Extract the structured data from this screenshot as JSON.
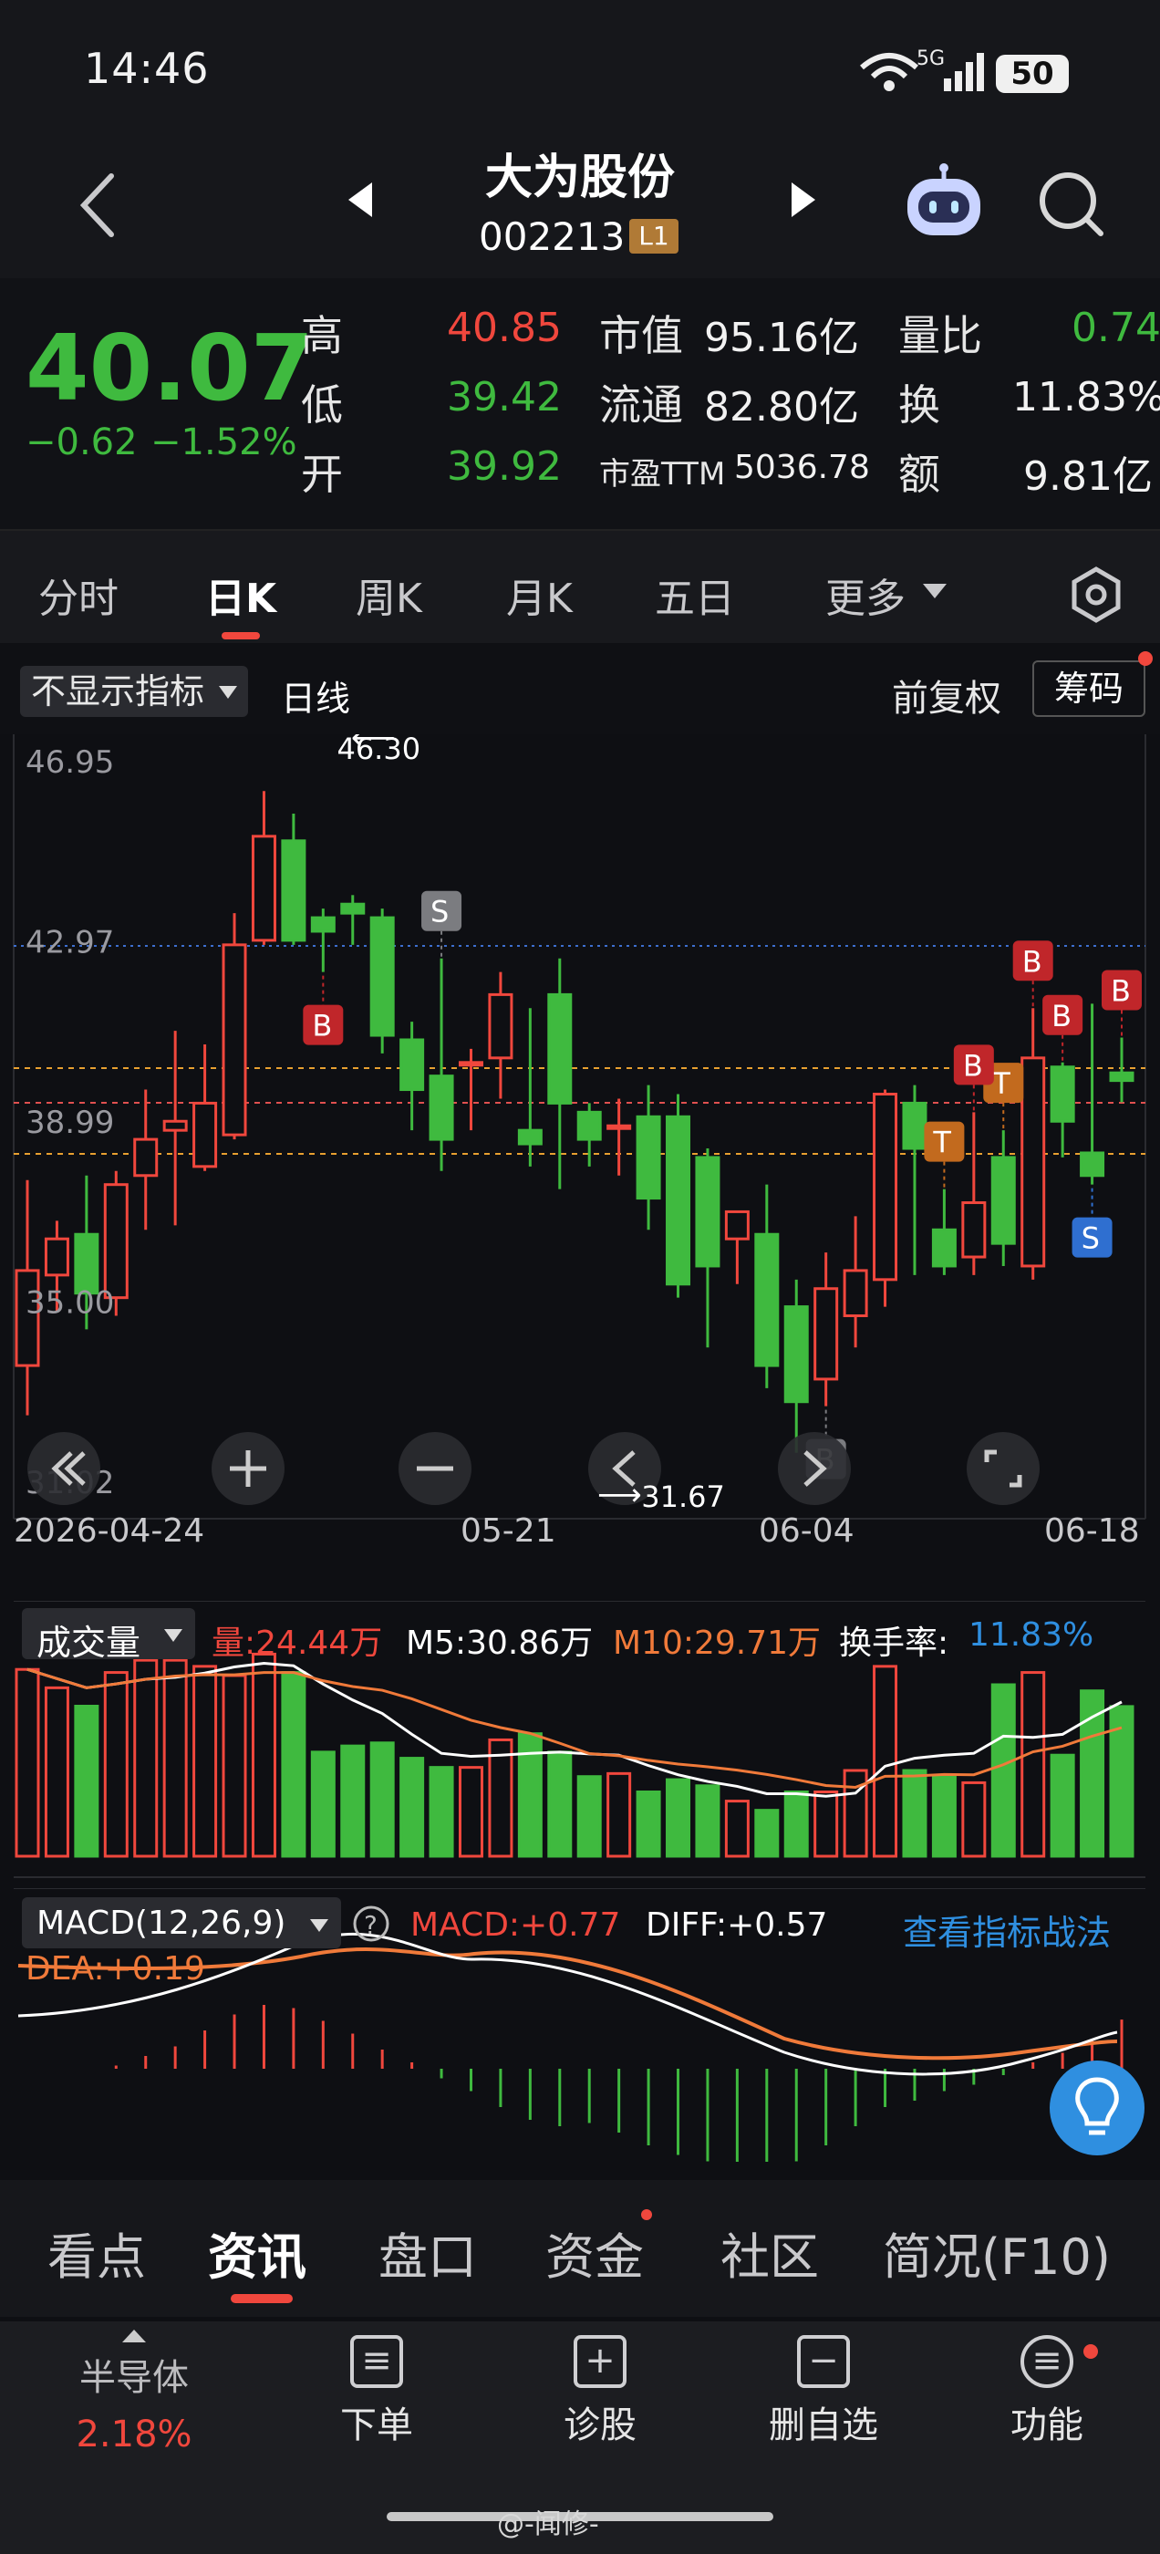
{
  "status": {
    "time": "14:46",
    "battery": "50",
    "network": "5G"
  },
  "header": {
    "stock_name": "大为股份",
    "stock_code": "002213",
    "level": "L1"
  },
  "quote": {
    "price": "40.07",
    "change": "−0.62",
    "change_pct": "−1.52%",
    "high_label": "高",
    "high": "40.85",
    "low_label": "低",
    "low": "39.42",
    "open_label": "开",
    "open": "39.92",
    "mktcap_label": "市值",
    "mktcap": "95.16亿",
    "float_label": "流通",
    "float": "82.80亿",
    "pe_label": "市盈TTM",
    "pe": "5036.78",
    "volratio_label": "量比",
    "volratio": "0.74",
    "turnover_label": "换",
    "turnover": "11.83%",
    "amount_label": "额",
    "amount": "9.81亿"
  },
  "period_tabs": [
    "分时",
    "日K",
    "周K",
    "月K",
    "五日",
    "更多"
  ],
  "chart_toolbar": {
    "indicator": "不显示指标",
    "line_type": "日线",
    "adjust": "前复权",
    "chips": "筹码"
  },
  "kline": {
    "y_ticks": [
      "46.95",
      "42.97",
      "38.99",
      "35.00",
      "31.02"
    ],
    "high_note": "46.30",
    "low_note": "31.67",
    "x_ticks": [
      "2026-04-24",
      "05-21",
      "06-04",
      "06-18"
    ]
  },
  "volume": {
    "selector": "成交量",
    "vol_label": "量:24.44万",
    "m5_label": "M5:30.86万",
    "m10_label": "M10:29.71万",
    "turnover_label": "换手率:",
    "turnover_value": "11.83%"
  },
  "macd": {
    "selector": "MACD(12,26,9)",
    "macd_label": "MACD:+0.77",
    "diff_label": "DIFF:+0.57",
    "dea_label": "DEA:+0.19",
    "link": "查看指标战法"
  },
  "info_tabs": [
    "看点",
    "资讯",
    "盘口",
    "资金",
    "社区",
    "简况(F10)"
  ],
  "bottom_bar": {
    "sector_name": "半导体",
    "sector_change": "2.18%",
    "items": [
      "下单",
      "诊股",
      "删自选",
      "功能"
    ]
  },
  "watermark": "@-闻修-",
  "colors": {
    "up": "#f0473d",
    "down": "#3fba3f",
    "bg": "#0e0f13",
    "accent": "#2f8fe0"
  },
  "chart_data": {
    "type": "candlestick",
    "title": "日线",
    "x": [
      "04-24",
      "04-27",
      "04-28",
      "04-29",
      "04-30",
      "05-06",
      "05-07",
      "05-08",
      "05-11",
      "05-12",
      "05-13",
      "05-14",
      "05-15",
      "05-18",
      "05-19",
      "05-20",
      "05-21",
      "05-22",
      "05-25",
      "05-26",
      "05-27",
      "05-28",
      "05-29",
      "06-01",
      "06-02",
      "06-03",
      "06-04",
      "06-05",
      "06-08",
      "06-09",
      "06-10",
      "06-11",
      "06-12",
      "06-15",
      "06-16",
      "06-17",
      "06-18",
      "06-19"
    ],
    "open": [
      33.6,
      35.6,
      36.5,
      35.1,
      37.8,
      38.8,
      38.0,
      38.7,
      43.0,
      45.2,
      43.5,
      43.8,
      43.5,
      40.8,
      40.0,
      40.3,
      40.4,
      38.8,
      41.8,
      39.2,
      38.9,
      39.1,
      39.1,
      38.2,
      36.4,
      36.5,
      34.9,
      33.3,
      34.7,
      35.5,
      39.4,
      36.6,
      36.0,
      38.2,
      35.8,
      40.2,
      38.3,
      40.07
    ],
    "close": [
      35.7,
      36.4,
      35.2,
      37.6,
      38.6,
      39.0,
      39.4,
      42.9,
      45.3,
      43.0,
      43.2,
      43.6,
      40.9,
      39.7,
      38.6,
      40.3,
      41.8,
      38.5,
      39.4,
      38.6,
      38.9,
      37.3,
      35.4,
      35.8,
      37.0,
      33.6,
      32.8,
      35.3,
      35.7,
      39.6,
      38.4,
      35.8,
      37.2,
      36.3,
      40.4,
      39.0,
      37.8,
      39.9
    ],
    "high": [
      37.7,
      36.8,
      37.8,
      37.9,
      39.7,
      41.0,
      40.7,
      43.6,
      46.3,
      45.8,
      43.7,
      44.0,
      43.7,
      41.2,
      42.6,
      40.6,
      42.3,
      41.5,
      42.6,
      39.4,
      39.5,
      39.8,
      39.6,
      38.4,
      36.8,
      37.6,
      35.5,
      36.1,
      36.9,
      39.7,
      39.8,
      37.5,
      39.2,
      38.8,
      41.5,
      40.3,
      41.6,
      40.85
    ],
    "low": [
      32.5,
      34.8,
      34.4,
      34.7,
      36.6,
      36.7,
      37.9,
      38.6,
      42.9,
      42.9,
      42.3,
      42.9,
      40.5,
      38.8,
      37.9,
      38.8,
      39.5,
      38.0,
      37.5,
      38.0,
      37.8,
      36.6,
      35.1,
      34.0,
      35.4,
      33.1,
      31.67,
      32.7,
      34.0,
      34.9,
      35.6,
      35.6,
      35.6,
      35.8,
      35.5,
      38.2,
      37.6,
      39.42
    ],
    "ylim": [
      31.02,
      46.95
    ],
    "annotations": [
      {
        "label": "S",
        "date": "05-19"
      },
      {
        "label": "B",
        "date": "05-13"
      },
      {
        "label": "B",
        "date": "06-05"
      },
      {
        "label": "T",
        "date": "06-11"
      },
      {
        "label": "T",
        "date": "06-15"
      },
      {
        "label": "B",
        "date": "06-12"
      },
      {
        "label": "B",
        "date": "06-16"
      },
      {
        "label": "B",
        "date": "06-17"
      },
      {
        "label": "S",
        "date": "06-18"
      },
      {
        "label": "B",
        "date": "06-19"
      }
    ],
    "volume_values": [
      30.5,
      27.5,
      24.5,
      30.0,
      32.0,
      32.0,
      31.0,
      29.5,
      33.0,
      30.0,
      17.0,
      18.0,
      18.5,
      16.0,
      14.5,
      14.5,
      19.0,
      20.0,
      17.0,
      13.0,
      13.5,
      10.5,
      12.5,
      11.5,
      9.0,
      7.5,
      10.5,
      10.5,
      14.0,
      31.0,
      14.0,
      13.0,
      12.0,
      28.0,
      30.0,
      16.5,
      27.0,
      24.44
    ],
    "macd_hist": [
      0.0,
      0.0,
      0.0,
      0.05,
      0.2,
      0.35,
      0.6,
      0.85,
      1.0,
      0.95,
      0.75,
      0.55,
      0.3,
      0.1,
      -0.15,
      -0.35,
      -0.6,
      -0.8,
      -0.9,
      -0.85,
      -1.0,
      -1.2,
      -1.35,
      -1.45,
      -1.5,
      -1.55,
      -1.45,
      -1.2,
      -0.9,
      -0.6,
      -0.5,
      -0.35,
      -0.25,
      -0.1,
      0.1,
      0.25,
      0.45,
      0.77
    ]
  }
}
